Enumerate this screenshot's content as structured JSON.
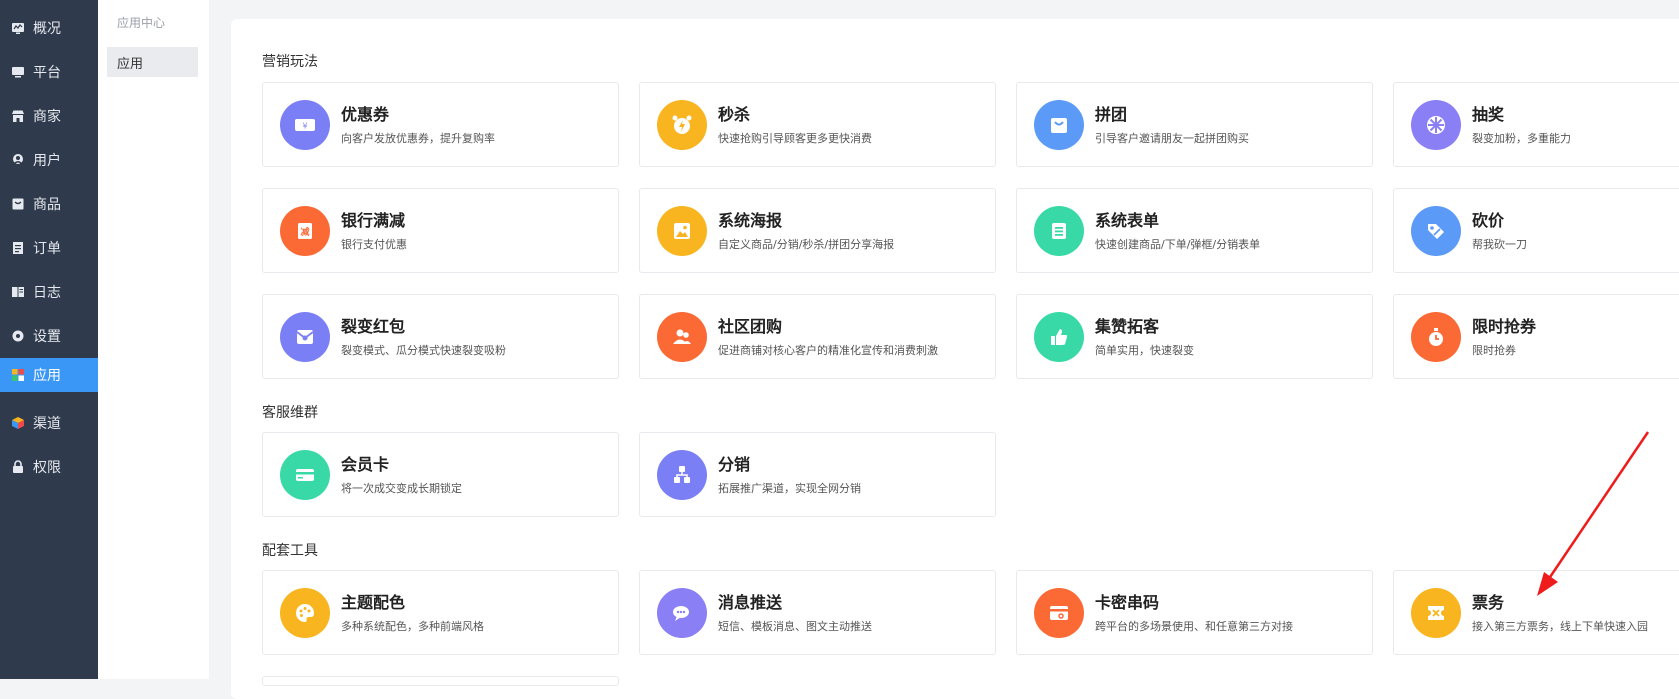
{
  "sidebar": {
    "items": [
      {
        "label": "概况",
        "icon": "dashboard-icon"
      },
      {
        "label": "平台",
        "icon": "monitor-icon"
      },
      {
        "label": "商家",
        "icon": "store-icon"
      },
      {
        "label": "用户",
        "icon": "user-icon"
      },
      {
        "label": "商品",
        "icon": "goods-icon"
      },
      {
        "label": "订单",
        "icon": "order-icon"
      },
      {
        "label": "日志",
        "icon": "log-icon"
      },
      {
        "label": "设置",
        "icon": "gear-icon"
      },
      {
        "label": "应用",
        "icon": "apps-icon",
        "active": true
      },
      {
        "label": "渠道",
        "icon": "cube-icon"
      },
      {
        "label": "权限",
        "icon": "lock-icon"
      }
    ]
  },
  "subpanel": {
    "title": "应用中心",
    "item": "应用"
  },
  "sections": {
    "marketing": "营销玩法",
    "service": "客服维群",
    "tools": "配套工具"
  },
  "cards": {
    "coupon": {
      "title": "优惠券",
      "desc": "向客户发放优惠券，提升复购率",
      "icon": "ticket-icon",
      "color": "#7b7ff5"
    },
    "seckill": {
      "title": "秒杀",
      "desc": "快速抢购引导顾客更多更快消费",
      "icon": "alarm-clock-icon",
      "color": "#f8b51f"
    },
    "group": {
      "title": "拼团",
      "desc": "引导客户邀请朋友一起拼团购买",
      "icon": "shopping-bag-icon",
      "color": "#5b9bf7"
    },
    "lottery": {
      "title": "抽奖",
      "desc": "裂变加粉，多重能力",
      "icon": "wheel-icon",
      "color": "#8a7ff5"
    },
    "bank": {
      "title": "银行满减",
      "desc": "银行支付优惠",
      "icon": "discount-icon",
      "color": "#fb6a35"
    },
    "poster": {
      "title": "系统海报",
      "desc": "自定义商品/分销/秒杀/拼团分享海报",
      "icon": "image-icon",
      "color": "#f8b51f"
    },
    "form": {
      "title": "系统表单",
      "desc": "快速创建商品/下单/弹框/分销表单",
      "icon": "form-icon",
      "color": "#38d9a6"
    },
    "bargain": {
      "title": "砍价",
      "desc": "帮我砍一刀",
      "icon": "price-tag-icon",
      "color": "#5b9bf7"
    },
    "redpacket": {
      "title": "裂变红包",
      "desc": "裂变模式、瓜分模式快速裂变吸粉",
      "icon": "red-packet-icon",
      "color": "#7b7ff5"
    },
    "community": {
      "title": "社区团购",
      "desc": "促进商铺对核心客户的精准化宣传和消费刺激",
      "icon": "people-icon",
      "color": "#fb6a35"
    },
    "like": {
      "title": "集赞拓客",
      "desc": "简单实用，快速裂变",
      "icon": "thumbs-up-icon",
      "color": "#38d9a6"
    },
    "flash": {
      "title": "限时抢券",
      "desc": "限时抢券",
      "icon": "timer-icon",
      "color": "#fb6a35"
    },
    "member": {
      "title": "会员卡",
      "desc": "将一次成交变成长期锁定",
      "icon": "card-icon",
      "color": "#38d9a6"
    },
    "distribution": {
      "title": "分销",
      "desc": "拓展推广渠道，实现全网分销",
      "icon": "network-icon",
      "color": "#7b7ff5"
    },
    "theme": {
      "title": "主题配色",
      "desc": "多种系统配色，多种前端风格",
      "icon": "palette-icon",
      "color": "#f8b51f"
    },
    "message": {
      "title": "消息推送",
      "desc": "短信、模板消息、图文主动推送",
      "icon": "chat-icon",
      "color": "#8a7ff5"
    },
    "cardkey": {
      "title": "卡密串码",
      "desc": "跨平台的多场景使用、和任意第三方对接",
      "icon": "key-card-icon",
      "color": "#fb6a35"
    },
    "ticket": {
      "title": "票务",
      "desc": "接入第三方票务，线上下单快速入园",
      "icon": "ticket-stub-icon",
      "color": "#f8b51f"
    }
  },
  "annotation": {
    "color": "#ee1c1c"
  }
}
